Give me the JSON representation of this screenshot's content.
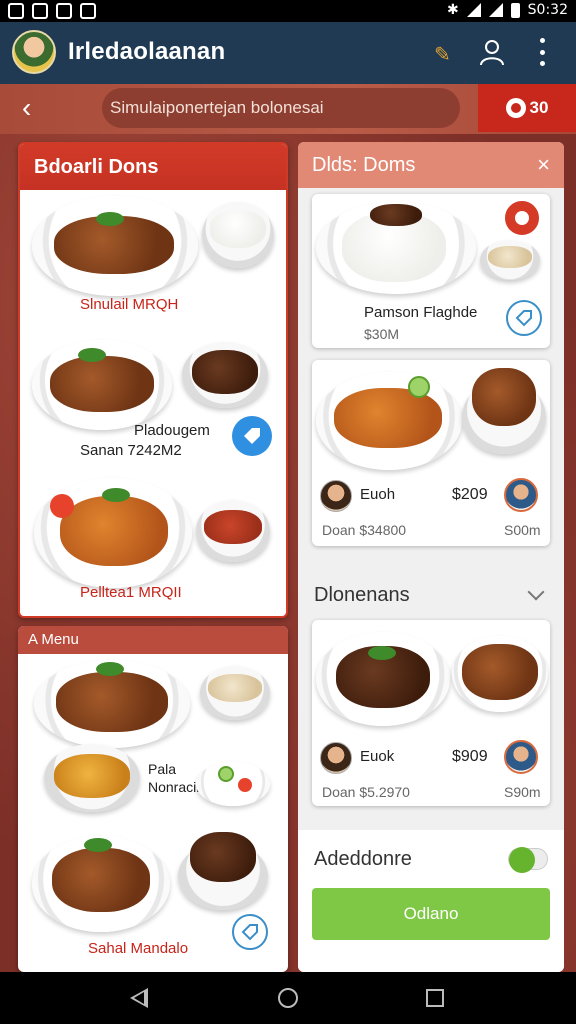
{
  "status_bar": {
    "time": "S0:32"
  },
  "app_bar": {
    "title": "Irledaolaanan"
  },
  "search": {
    "value": "Simulaiponertejan bolonesai"
  },
  "cart": {
    "label": "30"
  },
  "left_card_1": {
    "title": "Bdoarli Dons",
    "item1_label": "Slnulail MRQH",
    "item2_name": "Pladougem",
    "item2_price": "Sanan 7242M2",
    "item3_label": "Pelltea1 MRQII"
  },
  "left_card_2": {
    "title": "A Menu",
    "item2_name": "Pala Nonracinn",
    "item3_label": "Sahal Mandalo"
  },
  "right_panel": {
    "title": "Dlds: Doms",
    "close": "×",
    "item1": {
      "name": "Pamson Flaghde",
      "price": "$30M"
    },
    "item2": {
      "name": "Euoh",
      "price": "$209",
      "sub": "Doan $34800",
      "sub_price": "S00m"
    },
    "section_title": "Dlonenans",
    "item3": {
      "name": "Euok",
      "price": "$909",
      "sub": "Doan $5.2970",
      "sub_price": "S90m"
    },
    "addon_label": "Adeddonre",
    "order_button": "Odlano"
  },
  "icons": {
    "back": "arrow-left-icon",
    "search": "user-icon",
    "more": "more-vert-icon",
    "pen": "pen-icon"
  },
  "colors": {
    "appbar": "#1f3a52",
    "accent_red": "#d23a28",
    "salmon": "#e28975",
    "green": "#7ec845"
  }
}
